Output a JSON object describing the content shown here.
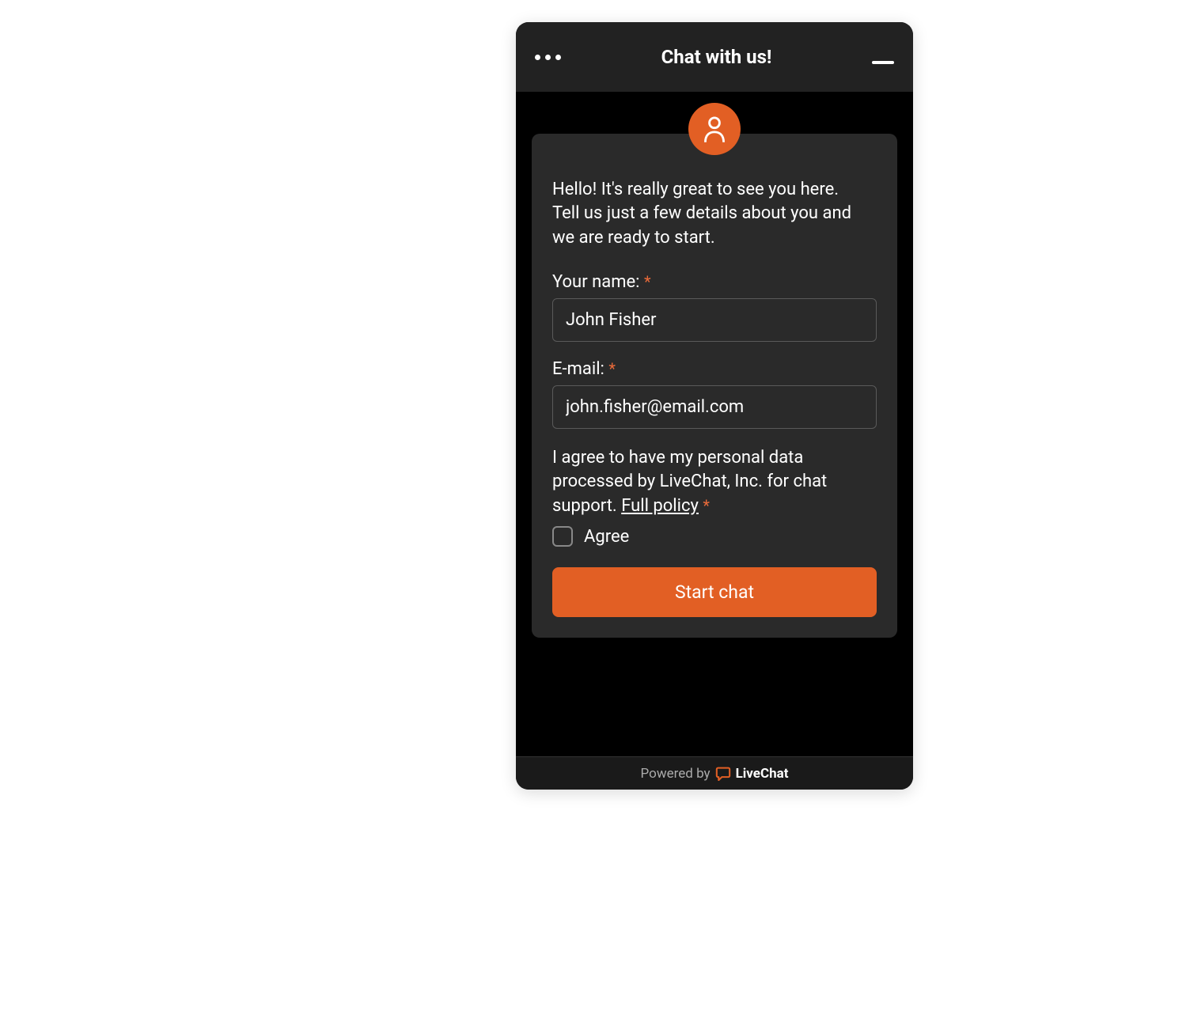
{
  "header": {
    "title": "Chat with us!"
  },
  "form": {
    "greeting_line1": "Hello! It's really great to see you here.",
    "greeting_line2": "Tell us just a few details about you and we are ready to start.",
    "name_label": "Your name:",
    "name_value": "John Fisher",
    "email_label": "E-mail:",
    "email_value": "john.fisher@email.com",
    "consent_text": "I agree to have my personal data processed by LiveChat, Inc. for chat support. ",
    "policy_link_text": "Full policy",
    "agree_label": "Agree",
    "submit_label": "Start chat"
  },
  "footer": {
    "powered_by": "Powered by",
    "brand": "LiveChat"
  },
  "colors": {
    "accent": "#e25f24",
    "background": "#000000",
    "card": "#2a2a2a",
    "header": "#222222"
  }
}
